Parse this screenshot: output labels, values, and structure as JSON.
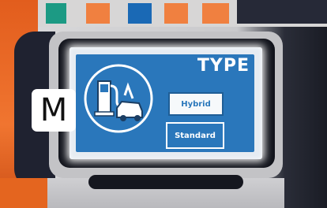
{
  "screen": {
    "title": "TYPE",
    "options": [
      {
        "label": "Hybrid",
        "selected": false
      },
      {
        "label": "Standard",
        "selected": true
      }
    ],
    "icon": "fuel-pump-car-icon"
  },
  "overlay": {
    "badge_label": "M"
  },
  "colors": {
    "screen_blue": "#2a77bb",
    "orange": "#f08040",
    "teal": "#1c9a84",
    "navy": "#262937"
  }
}
